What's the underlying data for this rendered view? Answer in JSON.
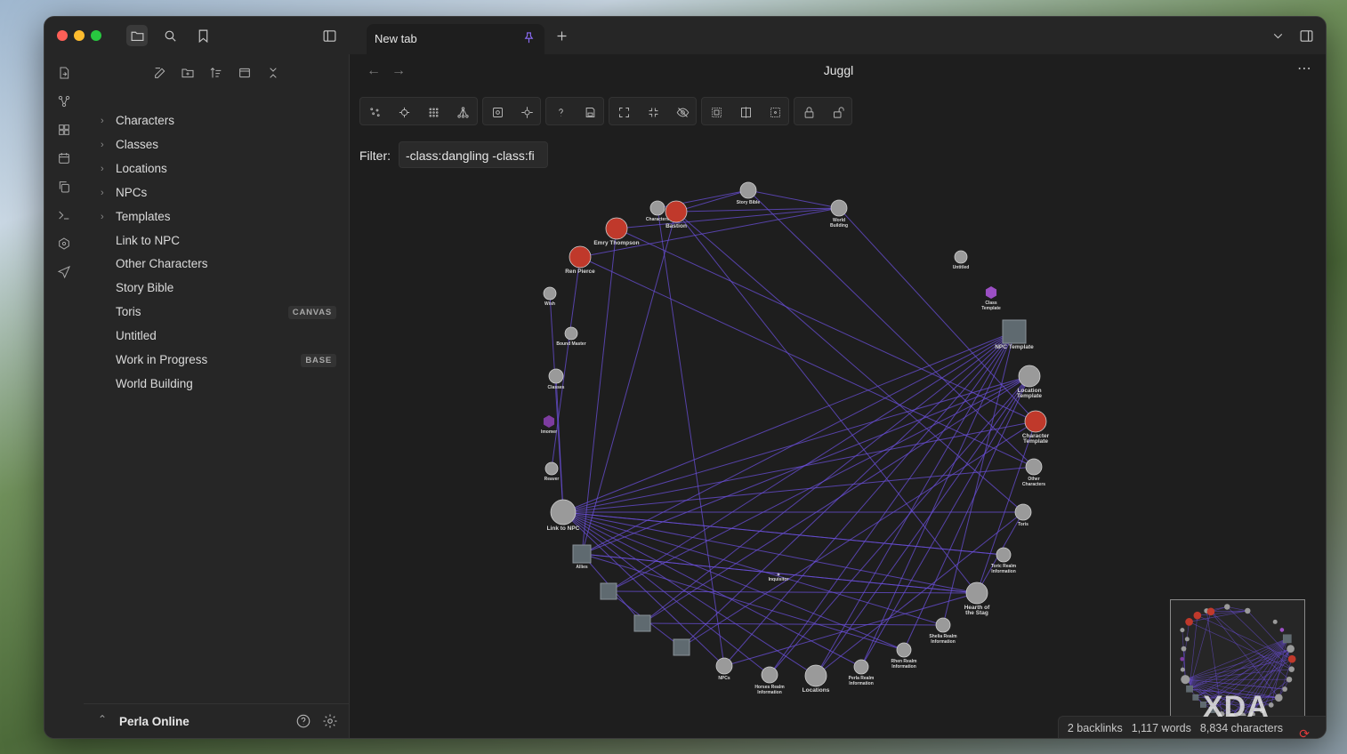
{
  "tab": {
    "label": "New tab"
  },
  "view": {
    "title": "Juggl"
  },
  "sidebar": {
    "items": [
      {
        "label": "Characters",
        "folder": true
      },
      {
        "label": "Classes",
        "folder": true
      },
      {
        "label": "Locations",
        "folder": true
      },
      {
        "label": "NPCs",
        "folder": true
      },
      {
        "label": "Templates",
        "folder": true
      },
      {
        "label": "Link to NPC"
      },
      {
        "label": "Other Characters"
      },
      {
        "label": "Story Bible"
      },
      {
        "label": "Toris",
        "badge": "CANVAS"
      },
      {
        "label": "Untitled"
      },
      {
        "label": "Work in Progress",
        "badge": "BASE"
      },
      {
        "label": "World Building"
      }
    ],
    "vault_name": "Perla Online"
  },
  "filter": {
    "label": "Filter:",
    "value": "-class:dangling -class:fi"
  },
  "graph": {
    "nodes": [
      {
        "label": "Story Bible",
        "shape": "circle",
        "color": "#9a9a9a"
      },
      {
        "label": "World Building",
        "shape": "circle",
        "color": "#9a9a9a"
      },
      {
        "label": "Characters",
        "shape": "circle",
        "color": "#9a9a9a"
      },
      {
        "label": "Bastion",
        "shape": "circle",
        "color": "#c0392b"
      },
      {
        "label": "Emry Thompson",
        "shape": "circle",
        "color": "#c0392b"
      },
      {
        "label": "Ren Pierce",
        "shape": "circle",
        "color": "#c0392b"
      },
      {
        "label": "Wish",
        "shape": "circle",
        "color": "#9a9a9a"
      },
      {
        "label": "Bound Master",
        "shape": "circle",
        "color": "#9a9a9a"
      },
      {
        "label": "Classes",
        "shape": "circle",
        "color": "#9a9a9a"
      },
      {
        "label": "Imomer",
        "shape": "hexagon",
        "color": "#7d3ca0"
      },
      {
        "label": "Reaver",
        "shape": "circle",
        "color": "#9a9a9a"
      },
      {
        "label": "Link to NPC",
        "shape": "circle",
        "color": "#9a9a9a"
      },
      {
        "label": "Allies",
        "shape": "square",
        "color": "#5f6a70"
      },
      {
        "label": "",
        "shape": "square",
        "color": "#5f6a70"
      },
      {
        "label": "",
        "shape": "square",
        "color": "#5f6a70"
      },
      {
        "label": "",
        "shape": "square",
        "color": "#5f6a70"
      },
      {
        "label": "NPCs",
        "shape": "circle",
        "color": "#9a9a9a"
      },
      {
        "label": "Horses Realm Information",
        "shape": "circle",
        "color": "#9a9a9a"
      },
      {
        "label": "Locations",
        "shape": "circle",
        "color": "#9a9a9a"
      },
      {
        "label": "Perla Realm Information",
        "shape": "circle",
        "color": "#9a9a9a"
      },
      {
        "label": "Rhen Realm Information",
        "shape": "circle",
        "color": "#9a9a9a"
      },
      {
        "label": "Shelia Realm Information",
        "shape": "circle",
        "color": "#9a9a9a"
      },
      {
        "label": "Hearth of the Stag",
        "shape": "circle",
        "color": "#9a9a9a"
      },
      {
        "label": "Toric Realm Information",
        "shape": "circle",
        "color": "#9a9a9a"
      },
      {
        "label": "Toris",
        "shape": "circle",
        "color": "#9a9a9a"
      },
      {
        "label": "Other Characters",
        "shape": "circle",
        "color": "#9a9a9a"
      },
      {
        "label": "Character Template",
        "shape": "circle",
        "color": "#c0392b"
      },
      {
        "label": "Location Template",
        "shape": "circle",
        "color": "#9a9a9a"
      },
      {
        "label": "NPC Template",
        "shape": "square",
        "color": "#5f6a70"
      },
      {
        "label": "Class Template",
        "shape": "hexagon",
        "color": "#9b4fc4"
      },
      {
        "label": "Untitled",
        "shape": "circle",
        "color": "#9a9a9a"
      },
      {
        "label": "Inquisitor",
        "shape": "dot",
        "color": "#7c62e8"
      }
    ],
    "edge_color": "#6a4fd8"
  },
  "status": {
    "backlinks": "2 backlinks",
    "words": "1,117 words",
    "characters": "8,834 characters"
  },
  "watermark": "XDA",
  "colors": {
    "accent": "#8b6cf6",
    "sync_error": "#e03b3b"
  }
}
